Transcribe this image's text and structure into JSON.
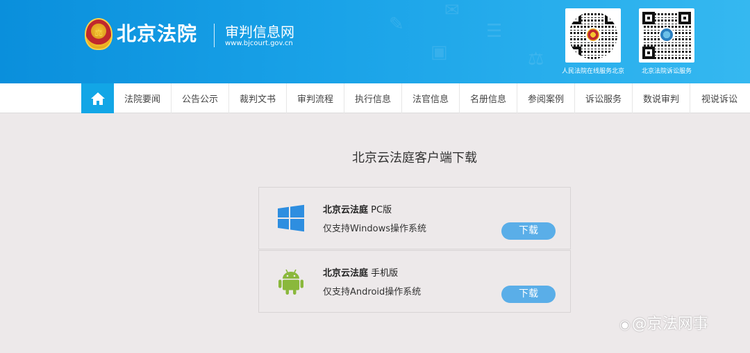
{
  "header": {
    "site_name": "北京法院",
    "sub_name": "审判信息网",
    "sub_url": "www.bjcourt.gov.cn",
    "qr_codes": [
      {
        "caption": "人民法院在线服务北京"
      },
      {
        "caption": "北京法院诉讼服务"
      }
    ]
  },
  "nav": {
    "home_icon": "home-icon",
    "items": [
      "法院要闻",
      "公告公示",
      "裁判文书",
      "审判流程",
      "执行信息",
      "法官信息",
      "名册信息",
      "参阅案例",
      "诉讼服务",
      "数说审判",
      "视说诉讼"
    ]
  },
  "main": {
    "title": "北京云法庭客户端下载",
    "cards": [
      {
        "name": "北京云法庭",
        "edition": "PC版",
        "desc": "仅支持Windows操作系统",
        "button": "下载",
        "icon": "windows-icon"
      },
      {
        "name": "北京云法庭",
        "edition": "手机版",
        "desc": "仅支持Android操作系统",
        "button": "下载",
        "icon": "android-icon"
      }
    ]
  },
  "watermark": "@京法网事",
  "colors": {
    "header_blue": "#0a8fdc",
    "nav_home": "#12a6e6",
    "button_blue": "#5aaee8",
    "windows_blue": "#2e8ee0",
    "android_green": "#8ab83c",
    "page_bg": "#ede9ea"
  }
}
